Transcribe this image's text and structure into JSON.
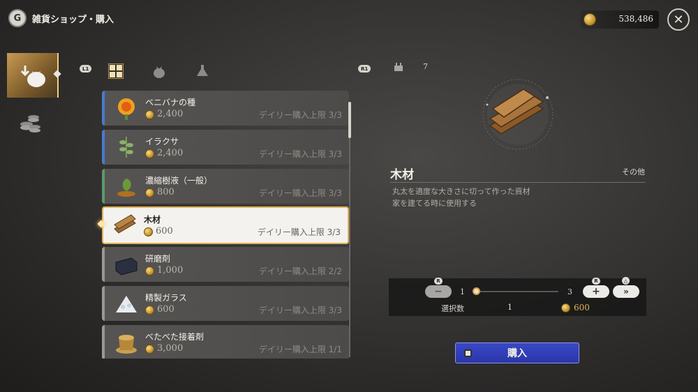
{
  "header": {
    "logo_letter": "G",
    "title": "雑貨ショップ・購入",
    "currency": "538,486"
  },
  "tabs": {
    "left_key": "L1",
    "right_key": "R1"
  },
  "items": [
    {
      "name": "ベニバナの種",
      "price": "2,400",
      "limit": "デイリー購入上限 3/3"
    },
    {
      "name": "イラクサ",
      "price": "2,400",
      "limit": "デイリー購入上限 3/3"
    },
    {
      "name": "濃縮樹液（一般）",
      "price": "800",
      "limit": "デイリー購入上限 3/3"
    },
    {
      "name": "木材",
      "price": "600",
      "limit": "デイリー購入上限 3/3"
    },
    {
      "name": "研磨剤",
      "price": "1,000",
      "limit": "デイリー購入上限 2/2"
    },
    {
      "name": "精製ガラス",
      "price": "600",
      "limit": "デイリー購入上限 3/3"
    },
    {
      "name": "べたべた接着剤",
      "price": "3,000",
      "limit": "デイリー購入上限 1/1"
    }
  ],
  "detail": {
    "owned": "7",
    "name": "木材",
    "category": "その他",
    "description_line1": "丸太を適度な大きさに切って作った資材",
    "description_line2": "家を建てる時に使用する"
  },
  "quantity": {
    "min_label": "1",
    "max_label": "3",
    "minus_key": "R",
    "plus_key": "R",
    "max_key": "△",
    "max_symbol": "»",
    "selected_label": "選択数",
    "selected_value": "1",
    "total": "600",
    "slider_fraction": 0
  },
  "buy_label": "購入",
  "colors": {
    "accent_gold": "#e0b25a",
    "buy_blue": "#2f3cb8"
  }
}
